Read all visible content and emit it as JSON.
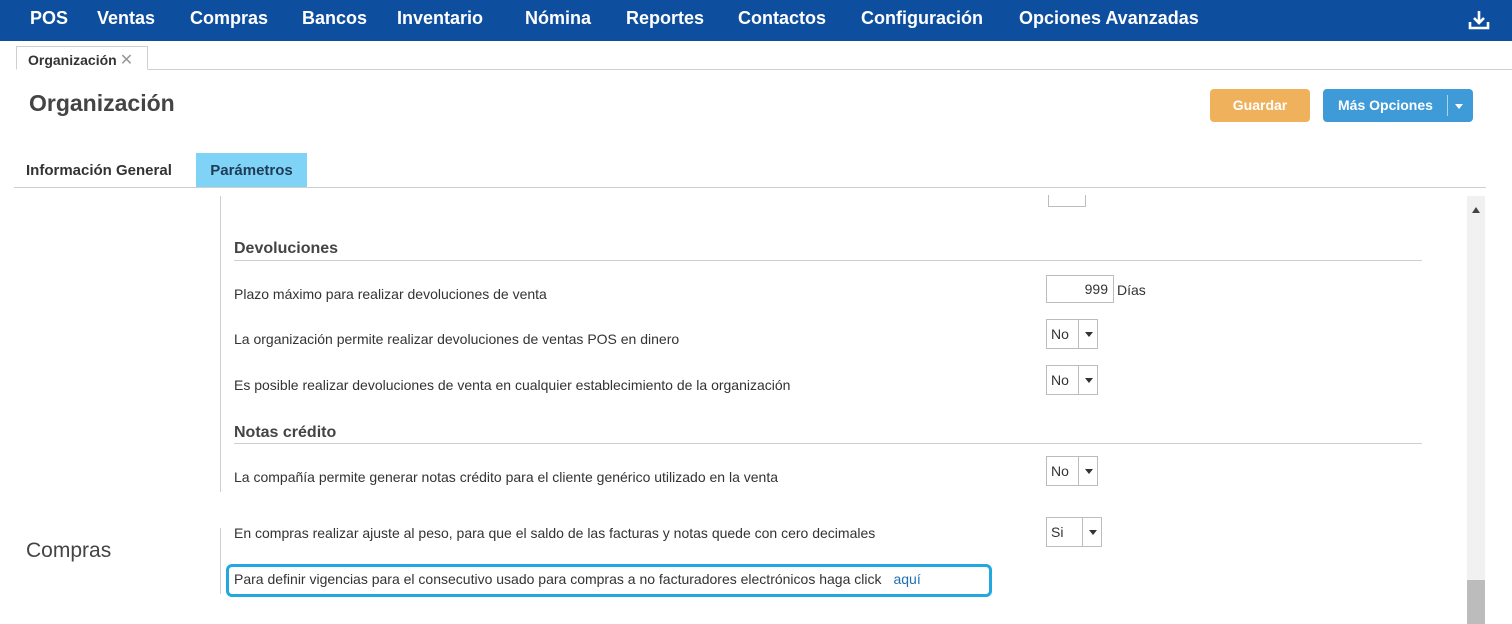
{
  "nav": {
    "items": [
      "POS",
      "Ventas",
      "Compras",
      "Bancos",
      "Inventario",
      "Nómina",
      "Reportes",
      "Contactos",
      "Configuración",
      "Opciones Avanzadas"
    ],
    "download_icon": "download-icon"
  },
  "page_tab": {
    "label": "Organización",
    "close": "✕"
  },
  "title": "Organización",
  "actions": {
    "save": "Guardar",
    "more": "Más Opciones"
  },
  "subtabs": {
    "general": "Información General",
    "params": "Parámetros"
  },
  "devoluciones": {
    "section": "Devoluciones",
    "plazo_label": "Plazo máximo para realizar devoluciones de venta",
    "plazo_value": "999",
    "plazo_unit": "Días",
    "dinero_label": "La organización permite realizar devoluciones de ventas POS en dinero",
    "dinero_value": "No",
    "establecimiento_label": "Es posible realizar devoluciones de venta en cualquier establecimiento de la organización",
    "establecimiento_value": "No"
  },
  "notas": {
    "section": "Notas crédito",
    "generico_label": "La compañía permite generar notas crédito para el cliente genérico utilizado en la venta",
    "generico_value": "No"
  },
  "compras": {
    "side_title": "Compras",
    "ajuste_label": "En compras realizar ajuste al peso, para que el saldo de las facturas y notas quede con cero decimales",
    "ajuste_value": "Si",
    "vigencias_label": "Para definir vigencias para el consecutivo usado para compras a no facturadores electrónicos haga click",
    "vigencias_link": "aquí"
  },
  "colors": {
    "nav_bg": "#0d4f9e",
    "save_button": "#f0b15c",
    "more_button": "#3e9bd8",
    "active_tab": "#7fd3f7",
    "highlight": "#22a7e0",
    "link": "#1f6fb3"
  }
}
